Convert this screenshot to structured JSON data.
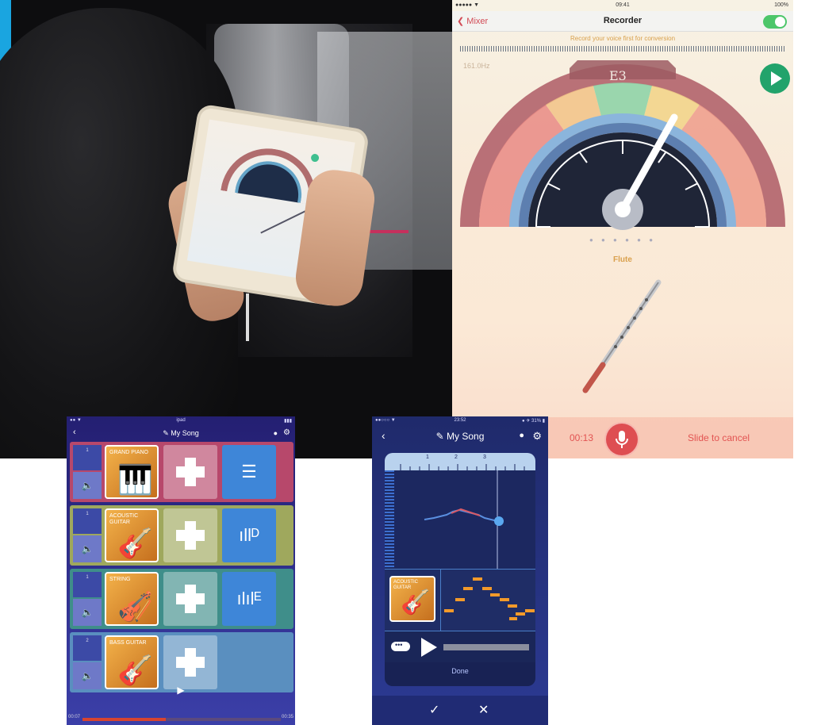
{
  "recorder": {
    "status": {
      "carrier": "●●●●● ▼",
      "time": "09:41",
      "battery": "100%"
    },
    "back_label": "Mixer",
    "title": "Recorder",
    "hint": "Record your voice first for conversion",
    "frequency": "161.0Hz",
    "note": "E3",
    "page_dots": "● ● ● ● ● ●",
    "instrument": "Flute",
    "elapsed": "00:13",
    "slide_cancel": "Slide to cancel",
    "colors": {
      "accent_green": "#22a36b",
      "record_red": "#de4e52",
      "label_amber": "#d9a04c"
    }
  },
  "mixer": {
    "status": {
      "left": "●● ▼",
      "center": "ipad",
      "right": "▮▮▮"
    },
    "song_title": "My Song",
    "tracks": [
      {
        "number": "1",
        "instrument": "GRAND PIANO",
        "icon": "piano-icon",
        "color": "#b7486b",
        "has_fx": true,
        "fx_icon": "sliders-icon"
      },
      {
        "number": "1",
        "instrument": "ACOUSTIC GUITAR",
        "icon": "guitar-icon",
        "color": "#9fa85d",
        "has_fx": true,
        "fx_icon": "chord-d-icon"
      },
      {
        "number": "1",
        "instrument": "STRING",
        "icon": "strings-icon",
        "color": "#3f8e8a",
        "has_fx": true,
        "fx_icon": "chord-e-icon"
      },
      {
        "number": "2",
        "instrument": "BASS GUITAR",
        "icon": "bass-icon",
        "color": "#5a8fbf",
        "has_fx": false,
        "fx_icon": ""
      }
    ],
    "play_label": "▶",
    "time_start": "00:07",
    "time_end": "00:35",
    "progress": 0.42
  },
  "song": {
    "status": {
      "left": "●●○○○ ▼",
      "center": "23:52",
      "right": "● ✈ 31% ▮"
    },
    "song_title": "My Song",
    "ruler_marks": [
      "1",
      "2",
      "3"
    ],
    "instrument": "ACOUSTIC GUITAR",
    "done_label": "Done",
    "check_label": "✓",
    "cross_label": "✕"
  }
}
